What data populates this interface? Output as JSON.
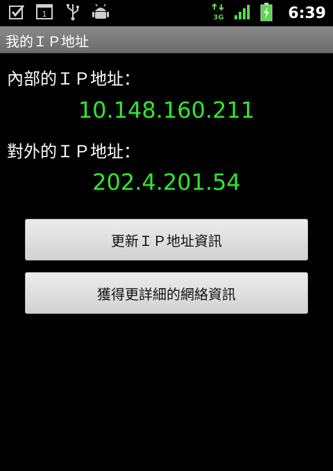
{
  "status_bar": {
    "time": "6:39",
    "left_icons": [
      "checkbox-notification-icon",
      "calendar-icon",
      "usb-icon",
      "android-debug-icon"
    ],
    "right_icons": [
      "3g-data-icon",
      "signal-strength-icon",
      "battery-charging-icon"
    ],
    "calendar_day": "1",
    "network_label": "3G"
  },
  "app": {
    "title": "我的ＩＰ地址"
  },
  "main": {
    "internal_label": "內部的ＩＰ地址：",
    "internal_ip": "10.148.160.211",
    "external_label": "對外的ＩＰ地址：",
    "external_ip": "202.4.201.54",
    "refresh_button": "更新ＩＰ地址資訊",
    "details_button": "獲得更詳細的網絡資訊"
  },
  "colors": {
    "ip_text": "#2ee82e",
    "background": "#000000",
    "title_bar": "#7a7a7a"
  }
}
